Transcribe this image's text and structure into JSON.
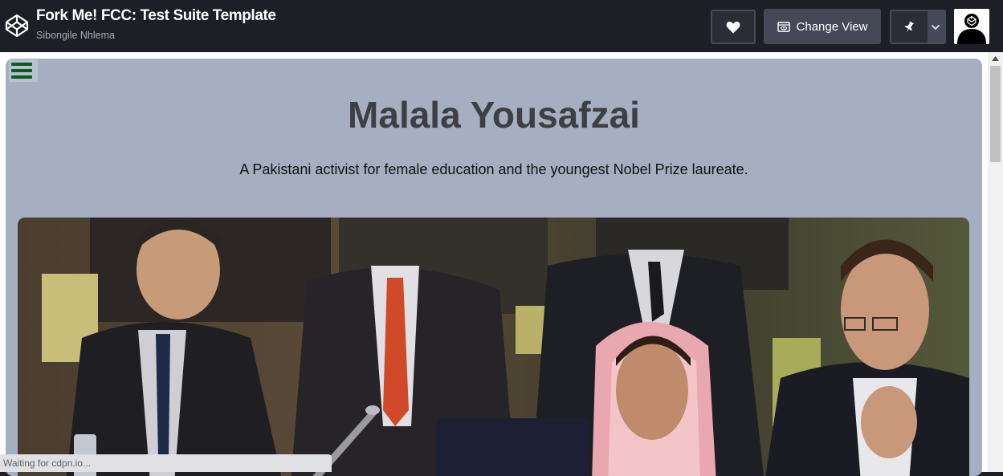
{
  "header": {
    "title": "Fork Me! FCC: Test Suite Template",
    "author": "Sibongile Nhlema",
    "change_view_label": "Change View",
    "icons": [
      "codepen-logo-icon",
      "heart-icon",
      "eye-icon",
      "pin-icon",
      "chevron-down-icon",
      "avatar"
    ]
  },
  "page": {
    "title": "Malala Yousafzai",
    "subtitle": "A Pakistani activist for female education and the youngest Nobel Prize laureate.",
    "background": "#a5afc1",
    "title_color": "#3c3f43",
    "menu_icon_color": "#0c5a20"
  },
  "status_bar": {
    "text": "Waiting for cdpn.io..."
  }
}
